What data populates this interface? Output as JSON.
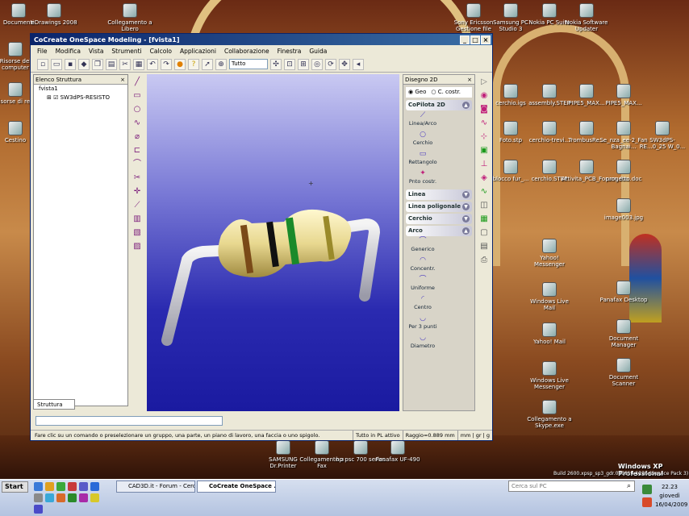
{
  "window": {
    "title": "CoCreate OneSpace Modeling - [fvista1]",
    "min": "_",
    "max": "□",
    "close": "×"
  },
  "menu": [
    "File",
    "Modifica",
    "Vista",
    "Strumenti",
    "Calcolo",
    "Applicazioni",
    "Collaborazione",
    "Finestra",
    "Guida"
  ],
  "toolbar": {
    "filter_value": "Tutto"
  },
  "tree": {
    "title": "Elenco Struttura",
    "root": "fvista1",
    "item": "SW3dPS-RESISTO",
    "tab": "Struttura"
  },
  "panel": {
    "title": "Disegno 2D",
    "radio_geo": "Geo",
    "radio_costr": "C. costr.",
    "copilota": {
      "header": "CoPilota 2D",
      "items": [
        "Linea/Arco",
        "Cerchio",
        "Rettangolo",
        "Pnto costr."
      ]
    },
    "linea": "Linea",
    "linea_poligonale": "Linea poligonale",
    "cerchio": "Cerchio",
    "arco": {
      "header": "Arco",
      "items": [
        "Generico",
        "Concentr.",
        "Uniforme",
        "Centro",
        "Per 3 punti",
        "Diametro"
      ]
    }
  },
  "status": {
    "hint": "Fare clic su un comando o preselezionare un gruppo, una parte, un piano di lavoro, una faccia o uno spigolo.",
    "pl": "Tutto in PL attivo",
    "raggio": "Raggio=0.889 mm",
    "units": "mm | gr | g"
  },
  "desktop": {
    "left": [
      "Documenti",
      "eDrawings 2008",
      "Risorse del computer",
      "Risorse di rete",
      "Cestino"
    ],
    "top": [
      "Collegamento a Libero",
      "Sony Ericsson Gestione file",
      "Samsung PC Studio 3",
      "Nokia PC Suite",
      "Nokia Software Updater"
    ],
    "right": [
      "cerchio.igs",
      "assembly.STEP",
      "PIPE5_MAX...",
      "PIPE5_MAX...",
      "Foto.stp",
      "cerchio-trevi...",
      "TrombusRe...",
      "Se_nza_ee-2_Fan Bagnai...",
      "SW3dPS-RE...0_25 W_0...",
      "blocco fur_...",
      "cerchio.STEP",
      "Attivita_PCB_Forum.doc",
      "progetto.doc",
      "image003.jpg",
      "Yahoo! Messenger",
      "Windows Live Mail",
      "Yahoo! Mail",
      "Windows Live Messenger",
      "Collegamento a Skype.exe",
      "Panafax Desktop",
      "Document Manager",
      "Document Scanner"
    ],
    "bottom": [
      "SAMSUNG Dr.Printer",
      "Collegamento a Fax",
      "hp psc 700 series",
      "Panafax UF-490"
    ],
    "watermark": "Windows XP Professional",
    "build": "Build 2600.xpsp_sp3_gdr.080814-1236 (Service Pack 3)"
  },
  "taskbar": {
    "start": "Start",
    "tasks": [
      "CAD3D.it - Forum - Cerc...",
      "CoCreate OneSpace ..."
    ],
    "search": "Cerca sul PC",
    "time": "22.23",
    "day": "giovedì",
    "date": "16/04/2009"
  },
  "colors": {
    "title": "#0a246a",
    "viewport_top": "#c9c9f2",
    "viewport_bottom": "#1a1aa0",
    "icon_magenta": "#c0207a"
  }
}
